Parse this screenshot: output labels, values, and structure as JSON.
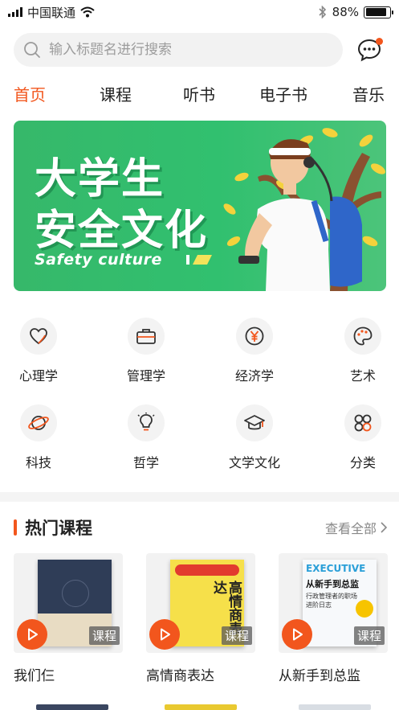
{
  "status": {
    "carrier": "中国联通",
    "battery": "88%",
    "battery_level": 0.88
  },
  "search": {
    "placeholder": "输入标题名进行搜索",
    "value": ""
  },
  "tabs": [
    {
      "label": "首页",
      "active": true
    },
    {
      "label": "课程",
      "active": false
    },
    {
      "label": "听书",
      "active": false
    },
    {
      "label": "电子书",
      "active": false
    },
    {
      "label": "音乐",
      "active": false
    }
  ],
  "banner": {
    "title_line1": "大学生",
    "title_line2": "安全文化",
    "subtitle": "Safety culture"
  },
  "categories": [
    {
      "label": "心理学",
      "icon": "heart-icon"
    },
    {
      "label": "管理学",
      "icon": "briefcase-icon"
    },
    {
      "label": "经济学",
      "icon": "yen-coin-icon"
    },
    {
      "label": "艺术",
      "icon": "palette-icon"
    },
    {
      "label": "科技",
      "icon": "planet-icon"
    },
    {
      "label": "哲学",
      "icon": "lightbulb-icon"
    },
    {
      "label": "文学文化",
      "icon": "graduation-cap-icon"
    },
    {
      "label": "分类",
      "icon": "grid-icon"
    }
  ],
  "hot": {
    "title": "热门课程",
    "see_all": "查看全部",
    "courses": [
      {
        "title": "我们仨",
        "tag": "课程"
      },
      {
        "title": "高情商表达",
        "tag": "课程",
        "cover_text": "高情商表达"
      },
      {
        "title": "从新手到总监",
        "tag": "课程",
        "cover_en": "EXECUTIVE",
        "cover_text": "从新手到总监",
        "cover_sub": "行政管理者的职场进阶日志"
      }
    ]
  },
  "colors": {
    "accent": "#f2561d",
    "banner_green": "#34bb6c"
  }
}
